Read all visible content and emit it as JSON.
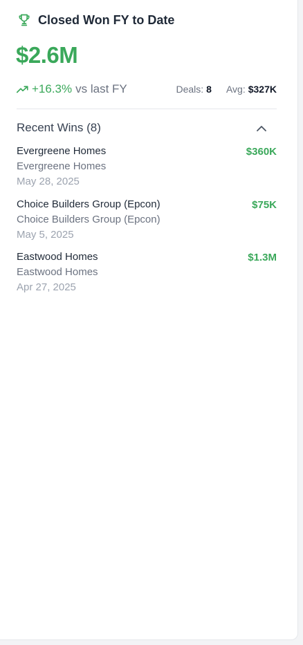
{
  "widget": {
    "title": "Closed Won FY to Date",
    "total_value": "$2.6M",
    "trend_percent": "+16.3%",
    "trend_label": "vs last FY",
    "deals_label": "Deals:",
    "deals_value": "8",
    "avg_label": "Avg:",
    "avg_value": "$327K"
  },
  "recent_wins": {
    "title": "Recent Wins (8)",
    "expanded": true,
    "items": [
      {
        "name": "Evergreene Homes",
        "company": "Evergreene Homes",
        "date": "May 28, 2025",
        "amount": "$360K"
      },
      {
        "name": "Choice Builders Group (Epcon)",
        "company": "Choice Builders Group (Epcon)",
        "date": "May 5, 2025",
        "amount": "$75K"
      },
      {
        "name": "Eastwood Homes",
        "company": "Eastwood Homes",
        "date": "Apr 27, 2025",
        "amount": "$1.3M"
      }
    ]
  },
  "colors": {
    "accent_green": "#3aa85a",
    "text_dark": "#1f2937",
    "text_muted": "#6b7280",
    "text_faint": "#9ca3af"
  },
  "icons": {
    "header": "trophy-icon",
    "trend": "trending-up-icon",
    "collapse": "chevron-up-icon"
  }
}
